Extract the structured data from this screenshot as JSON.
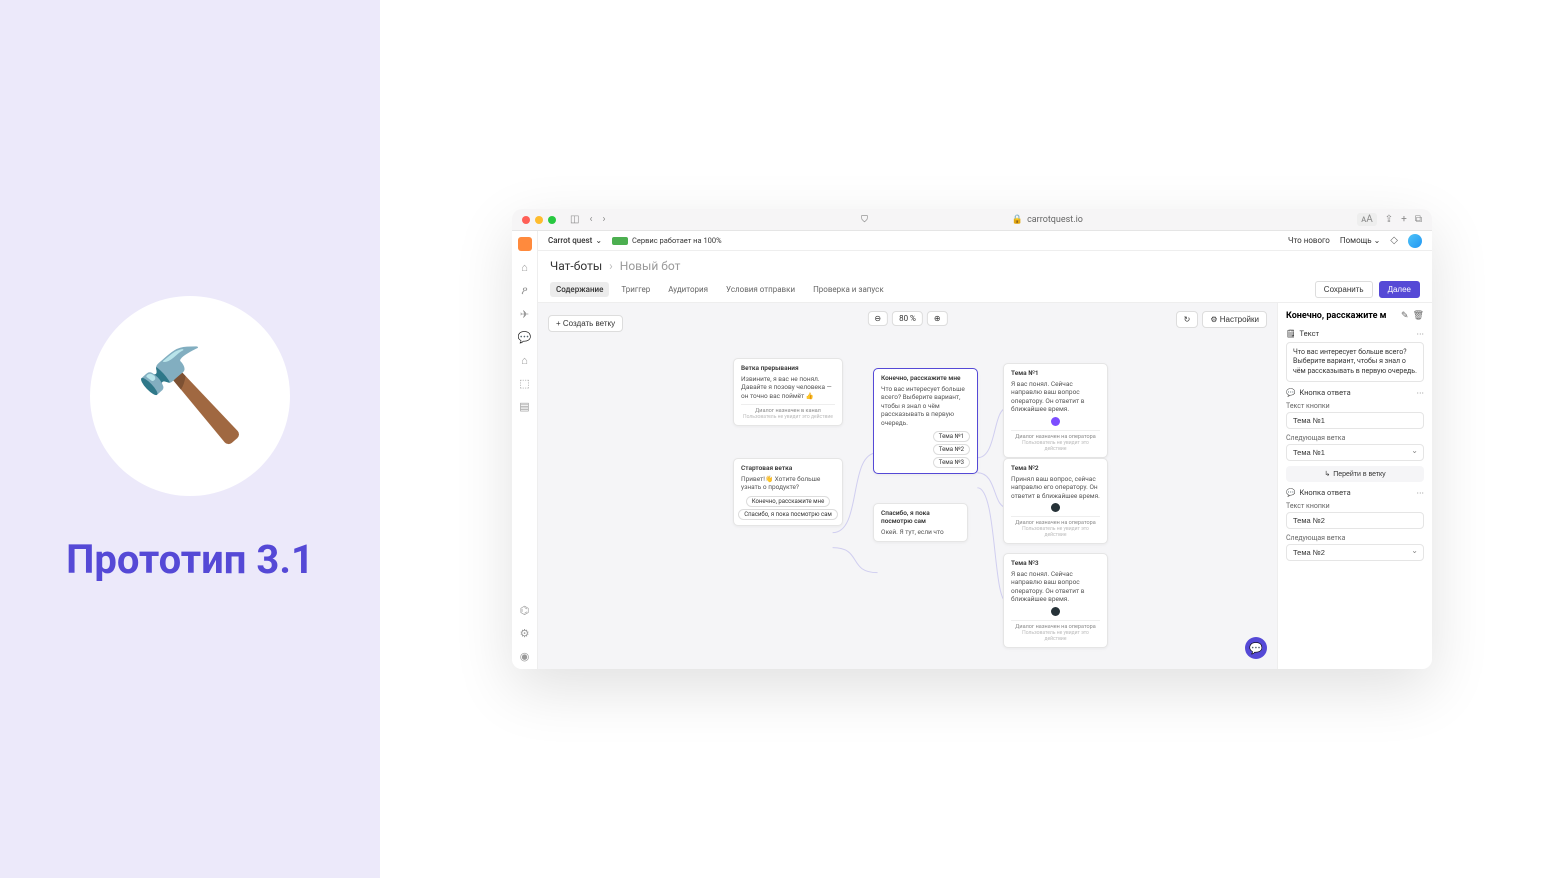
{
  "left": {
    "emoji": "🔨",
    "title": "Прототип 3.1"
  },
  "browser": {
    "url": "carrotquest.io",
    "aa": "ᴀA"
  },
  "topbar": {
    "workspace": "Carrot quest",
    "status": "Сервис работает на 100%",
    "whatsnew": "Что нового",
    "help": "Помощь"
  },
  "breadcrumb": {
    "root": "Чат-боты",
    "current": "Новый бот"
  },
  "tabs": {
    "content": "Содержание",
    "trigger": "Триггер",
    "audience": "Аудитория",
    "conditions": "Условия отправки",
    "launch": "Проверка и запуск",
    "save": "Сохранить",
    "next": "Далее"
  },
  "canvas_toolbar": {
    "create_branch": "+  Создать ветку",
    "zoom": "80 %",
    "settings": "⚙ Настройки"
  },
  "nodes": {
    "interrupt": {
      "title": "Ветка прерывания",
      "text": "Извините, я вас не понял. Давайте я позову человека — он точно вас поймёт 👍",
      "footer": "Диалог назначен в канал",
      "sub": "Пользователь не увидит это действие"
    },
    "start": {
      "title": "Стартовая ветка",
      "text": "Привет!👋\nХотите больше узнать о продукте?",
      "chip1": "Конечно, расскажите мне",
      "chip2": "Спасибо, я пока посмотрю сам"
    },
    "tellme": {
      "title": "Конечно, расскажите мне",
      "text": "Что вас интересует больше всего? Выберите вариант, чтобы я знал о чём рассказывать в первую очередь.",
      "chip1": "Тема №1",
      "chip2": "Тема №2",
      "chip3": "Тема №3"
    },
    "browse": {
      "title": "Спасибо, я пока посмотрю сам",
      "text": "Окей. Я тут, если что"
    },
    "t1": {
      "title": "Тема №1",
      "text": "Я вас понял. Сейчас направлю ваш вопрос оператору. Он ответит в ближайшее время.",
      "footer": "Диалог назначен на оператора",
      "sub": "Пользователь не увидит это действие"
    },
    "t2": {
      "title": "Тема №2",
      "text": "Принял ваш вопрос, сейчас направлю его оператору. Он ответит в ближайшее время.",
      "footer": "Диалог назначен на оператора",
      "sub": "Пользователь не увидит это действие"
    },
    "t3": {
      "title": "Тема №3",
      "text": "Я вас понял. Сейчас направлю ваш вопрос оператору. Он ответит в ближайшее время.",
      "footer": "Диалог назначен на оператора",
      "sub": "Пользователь не увидит это действие"
    }
  },
  "props": {
    "title": "Конечно, расскажите м",
    "section_text": "Текст",
    "textbox": "Что вас интересует больше всего? Выберите вариант, чтобы я знал о чём рассказывать в первую очередь.",
    "answer_button": "Кнопка ответа",
    "btn_text_label": "Текст кнопки",
    "btn_text_1": "Тема №1",
    "next_branch_label": "Следующая ветка",
    "next_branch_1": "Тема №1",
    "go_to_branch": "Перейти в ветку",
    "btn_text_2": "Тема №2",
    "next_branch_2": "Тема №2"
  }
}
